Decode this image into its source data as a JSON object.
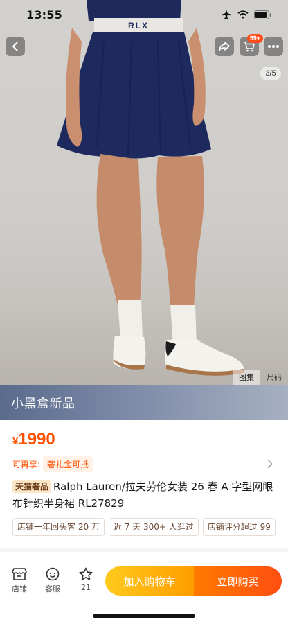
{
  "status_bar": {
    "time": "13:55"
  },
  "header": {
    "cart_badge": "99+",
    "image_counter": "3/5"
  },
  "image": {
    "waistband_text": "RLX",
    "links": [
      "图集",
      "尺码"
    ]
  },
  "banner": {
    "title": "小黑盒新品"
  },
  "product": {
    "currency": "¥",
    "price": "1990",
    "rebuy_label": "可再享:",
    "rebuy_tag": "奢礼金可抵",
    "store_tag": "天猫奢品",
    "title": "Ralph Lauren/拉夫劳伦女装 26 春 A 字型网眼布针织半身裙 RL27829",
    "tags": [
      "店铺一年回头客 20 万",
      "近 7 天 300+ 人逛过",
      "店铺评分超过 99"
    ]
  },
  "bottom_bar": {
    "store_label": "店铺",
    "service_label": "客服",
    "favorite_count": "21",
    "add_to_cart": "加入购物车",
    "buy_now": "立即购买"
  },
  "colors": {
    "accent": "#ff5000",
    "cart_button": "#ffb000",
    "buy_button": "#ff5a0a",
    "banner": "#6c7a98",
    "skirt": "#1f2a5c"
  }
}
